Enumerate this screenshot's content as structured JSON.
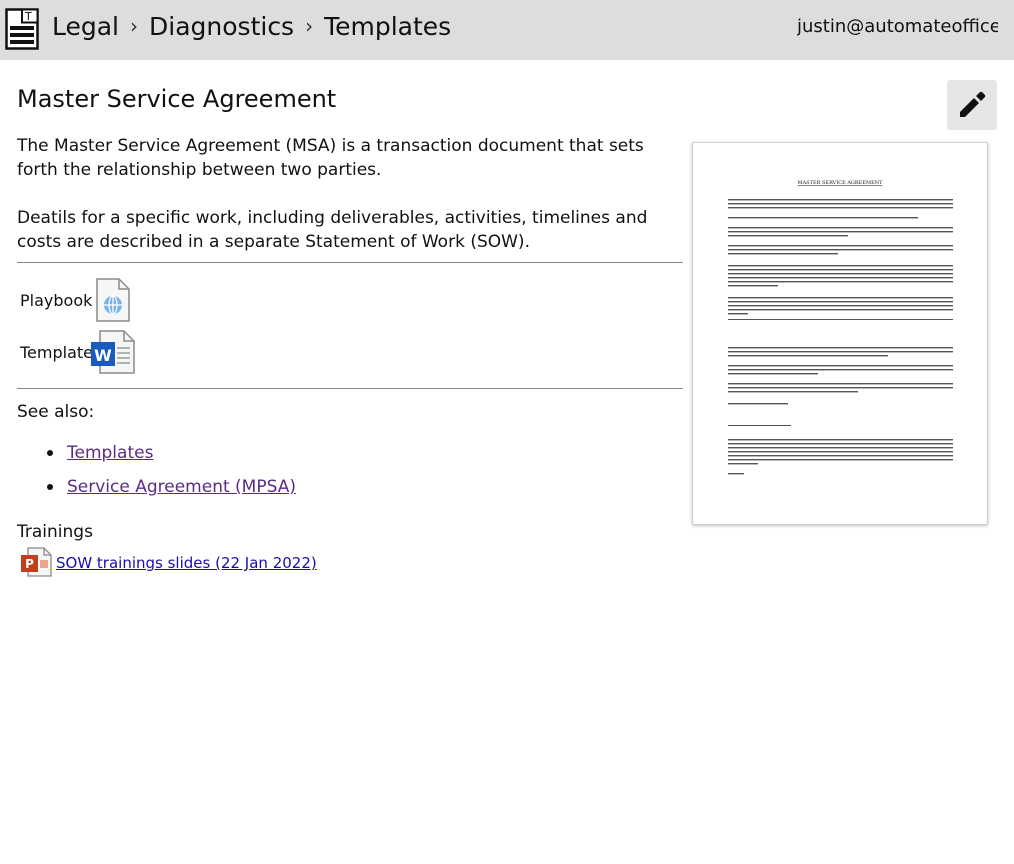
{
  "header": {
    "breadcrumb": [
      "Legal",
      "Diagnostics",
      "Templates"
    ],
    "separator": "›",
    "user": "justin@automateofficewc"
  },
  "page": {
    "title": "Master Service Agreement",
    "description": [
      "The Master Service Agreement (MSA) is a transaction document that sets forth the relationship between two parties.",
      "Deatils for a specific work, including deliverables, activities, timelines and costs are described in a separate Statement of Work (SOW)."
    ]
  },
  "files": [
    {
      "label": "Playbook",
      "icon": "web-document-icon"
    },
    {
      "label": "Template",
      "icon": "word-document-icon"
    }
  ],
  "see_also": {
    "heading": "See also:",
    "links": [
      "Templates",
      "Service Agreement (MPSA)"
    ]
  },
  "trainings": {
    "heading": "Trainings",
    "items": [
      {
        "label": "SOW trainings slides (22 Jan 2022)",
        "icon": "powerpoint-icon"
      }
    ]
  },
  "preview": {
    "doc_title": "MASTER SERVICE AGREEMENT"
  },
  "colors": {
    "header_bg": "#dddddd",
    "visited_link": "#5b2b80",
    "link": "#1a0dab",
    "word_blue": "#185abd",
    "powerpoint_orange": "#c43e1c"
  }
}
